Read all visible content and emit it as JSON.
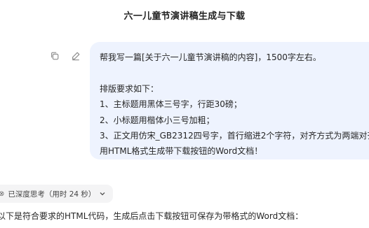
{
  "title": "六一儿童节演讲稿生成与下载",
  "actions": {
    "copy_icon": "copy-icon",
    "edit_icon": "edit-icon"
  },
  "user_message": {
    "lines": [
      "帮我写一篇[关于六一儿童节演讲稿的内容]，1500字左右。",
      "",
      "排版要求如下：",
      "1、主标题用黑体三号字，行距30磅；",
      "2、小标题用楷体小三号加粗；",
      "3、正文用仿宋_GB2312四号字，首行缩进2个字符，对齐方式为两端对齐",
      "用HTML格式生成带下载按钮的Word文档！"
    ]
  },
  "thinking": {
    "label": "已深度思考（用时 24 秒）",
    "icon": "deep-think-icon",
    "chevron": "chevron-down-icon"
  },
  "answer_intro": "以下是符合要求的HTML代码，生成后点击下载按钮可保存为带格式的Word文档："
}
